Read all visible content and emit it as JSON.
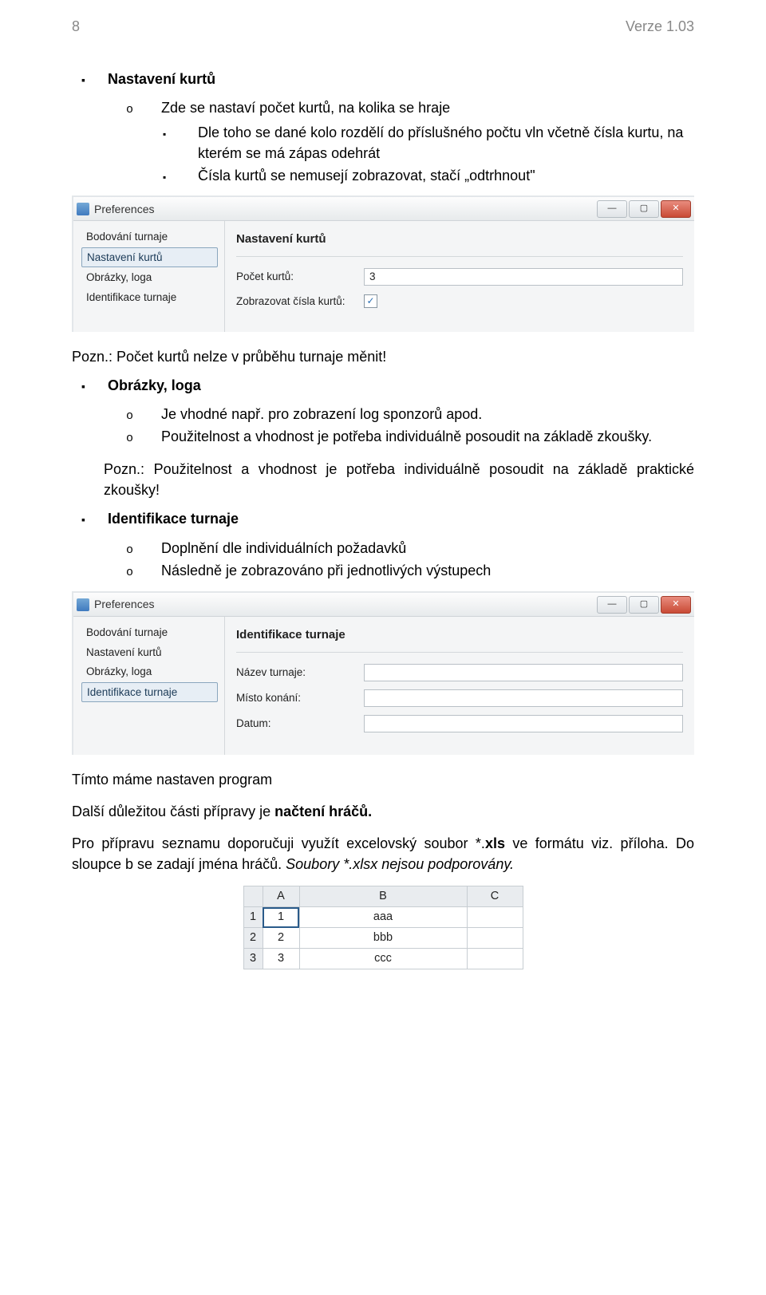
{
  "header": {
    "page_no": "8",
    "version": "Verze 1.03"
  },
  "sections": {
    "nastaveni_kurtu": {
      "title": "Nastavení kurtů",
      "o1": "Zde se nastaví počet kurtů, na kolika se hraje",
      "s1": "Dle toho se dané kolo rozdělí do příslušného počtu vln včetně čísla kurtu, na kterém se má zápas odehrát",
      "s2": "Čísla kurtů se nemusejí zobrazovat, stačí „odtrhnout\""
    },
    "note1": "Pozn.: Počet kurtů nelze v průběhu turnaje měnit!",
    "obrazky": {
      "title": "Obrázky, loga",
      "o1": "Je vhodné např. pro zobrazení log sponzorů apod.",
      "o2": "Použitelnost a vhodnost je potřeba individuálně posoudit na základě zkoušky."
    },
    "note2": "Pozn.: Použitelnost a vhodnost je potřeba individuálně posoudit na základě praktické zkoušky!",
    "ident": {
      "title": "Identifikace turnaje",
      "o1": "Doplnění dle individuálních požadavků",
      "o2": "Následně je zobrazováno při jednotlivých výstupech"
    },
    "closing": {
      "p1": "Tímto máme nastaven program",
      "p2a": "Další důležitou části přípravy je ",
      "p2b": "načtení hráčů.",
      "p3a": "Pro přípravu seznamu doporučuji využít excelovský soubor *.",
      "p3b": "xls",
      "p3c": " ve formátu viz. příloha. Do sloupce b se zadají jména hráčů. ",
      "p3d": "Soubory *.xlsx nejsou podporovány."
    }
  },
  "shot1": {
    "title": "Preferences",
    "sidebar": [
      "Bodování turnaje",
      "Nastavení kurtů",
      "Obrázky, loga",
      "Identifikace turnaje"
    ],
    "selected_index": 1,
    "heading": "Nastavení kurtů",
    "row1_label": "Počet kurtů:",
    "row1_value": "3",
    "row2_label": "Zobrazovat čísla kurtů:",
    "row2_checked": "✓"
  },
  "shot2": {
    "title": "Preferences",
    "sidebar": [
      "Bodování turnaje",
      "Nastavení kurtů",
      "Obrázky, loga",
      "Identifikace turnaje"
    ],
    "selected_index": 3,
    "heading": "Identifikace turnaje",
    "row1_label": "Název turnaje:",
    "row2_label": "Místo konání:",
    "row3_label": "Datum:"
  },
  "sheet": {
    "cols": [
      "A",
      "B",
      "C"
    ],
    "rows": [
      {
        "hdr": "1",
        "a": "1",
        "b": "aaa"
      },
      {
        "hdr": "2",
        "a": "2",
        "b": "bbb"
      },
      {
        "hdr": "3",
        "a": "3",
        "b": "ccc"
      }
    ]
  }
}
